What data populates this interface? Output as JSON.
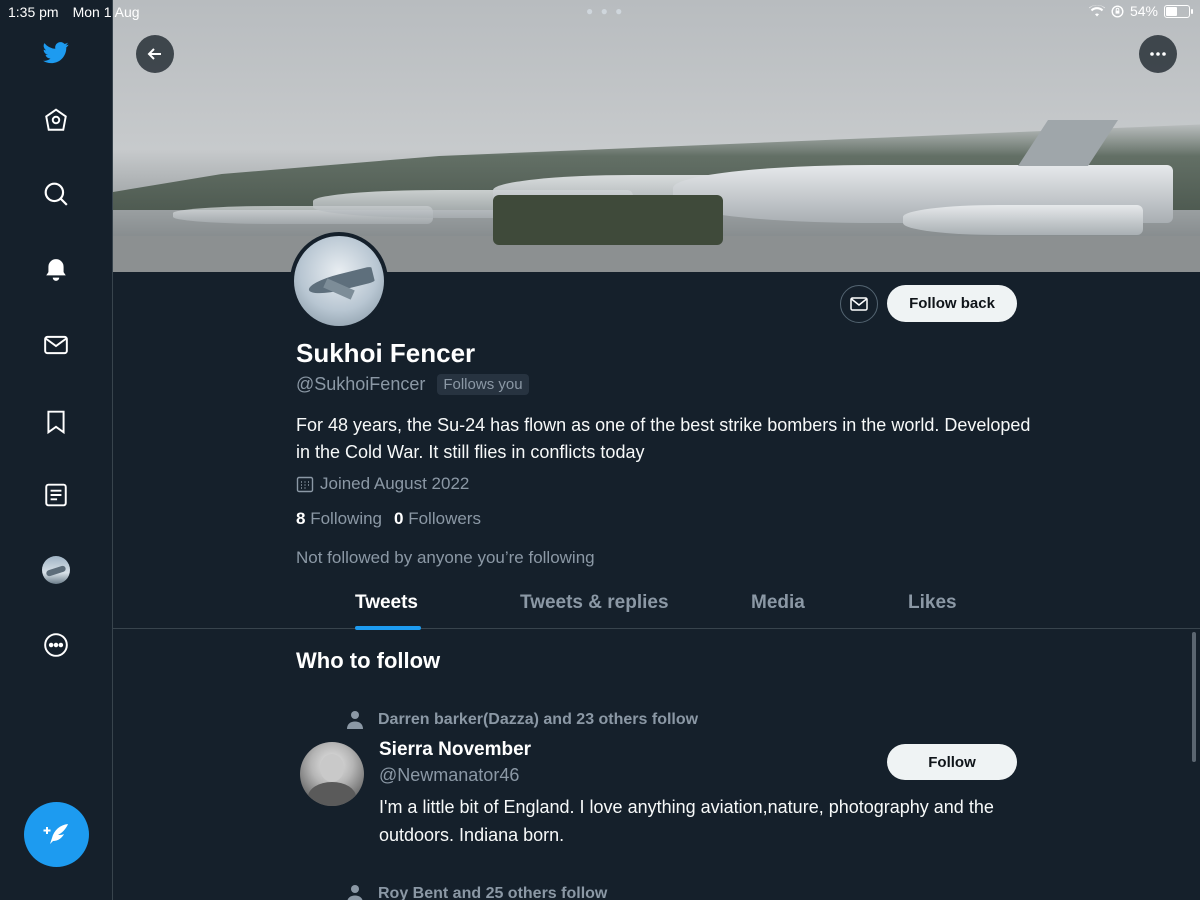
{
  "status_bar": {
    "time": "1:35 pm",
    "date": "Mon 1 Aug",
    "battery_text": "54%",
    "battery_level": 0.54
  },
  "sidebar": {
    "items": [
      {
        "name": "twitter-logo",
        "icon": "twitter-bird-icon"
      },
      {
        "name": "home",
        "icon": "home-icon"
      },
      {
        "name": "explore",
        "icon": "search-icon"
      },
      {
        "name": "notifications",
        "icon": "bell-icon"
      },
      {
        "name": "messages",
        "icon": "mail-icon"
      },
      {
        "name": "bookmarks",
        "icon": "bookmark-icon"
      },
      {
        "name": "lists",
        "icon": "list-icon"
      },
      {
        "name": "profile",
        "icon": "avatar"
      },
      {
        "name": "more",
        "icon": "more-circle-icon"
      }
    ],
    "compose_icon": "compose-feather-icon"
  },
  "profile": {
    "display_name": "Sukhoi Fencer",
    "handle": "@SukhoiFencer",
    "follows_you": "Follows you",
    "bio": "For 48 years, the Su-24 has flown as one of the best strike bombers in the world. Developed in the Cold War. It still flies in conflicts today",
    "joined": "Joined August 2022",
    "following_count": "8",
    "following_label": "Following",
    "followers_count": "0",
    "followers_label": "Followers",
    "not_followed": "Not followed by anyone you’re following",
    "follow_back_label": "Follow back"
  },
  "tabs": [
    "Tweets",
    "Tweets & replies",
    "Media",
    "Likes"
  ],
  "who_to_follow": {
    "title": "Who to follow",
    "suggestions": [
      {
        "context": "Darren barker(Dazza) and 23 others follow",
        "name": "Sierra November",
        "handle": "@Newmanator46",
        "bio": "I'm a little bit of England. I love anything aviation,nature, photography and the outdoors. Indiana born.",
        "follow_label": "Follow"
      },
      {
        "context": "Roy Bent and 25 others follow"
      }
    ]
  },
  "colors": {
    "background": "#15202b",
    "accent": "#1d9bf0",
    "secondary_text": "#8b98a5",
    "button_light": "#eff3f4"
  }
}
